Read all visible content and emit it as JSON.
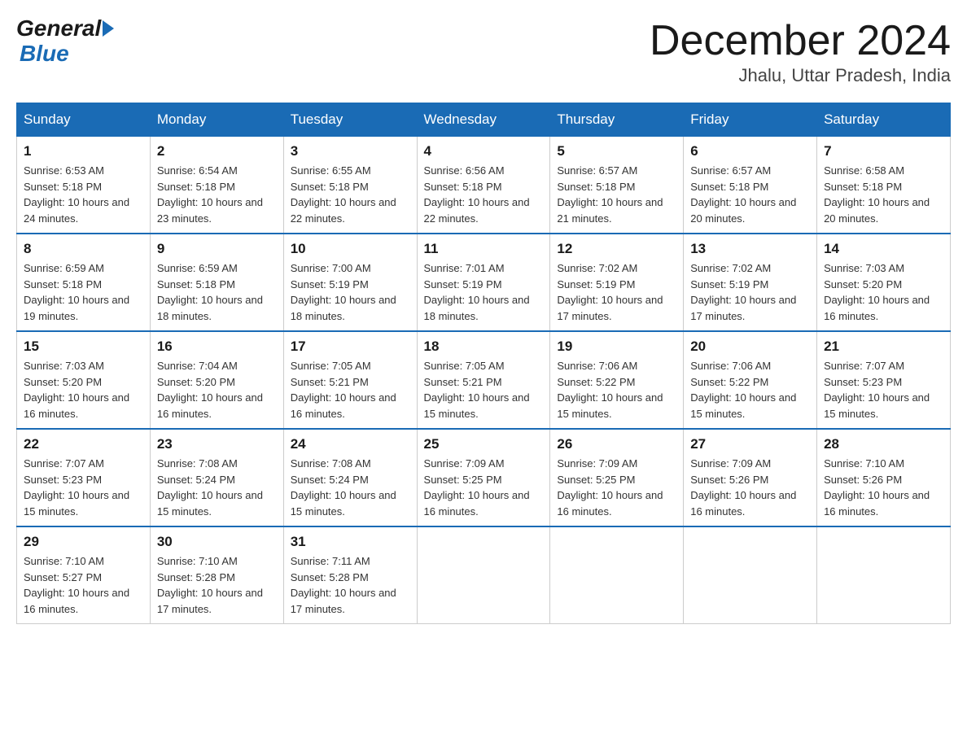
{
  "header": {
    "logo_general": "General",
    "logo_blue": "Blue",
    "month_year": "December 2024",
    "location": "Jhalu, Uttar Pradesh, India"
  },
  "days_of_week": [
    "Sunday",
    "Monday",
    "Tuesday",
    "Wednesday",
    "Thursday",
    "Friday",
    "Saturday"
  ],
  "weeks": [
    [
      {
        "day": "1",
        "sunrise": "6:53 AM",
        "sunset": "5:18 PM",
        "daylight": "10 hours and 24 minutes."
      },
      {
        "day": "2",
        "sunrise": "6:54 AM",
        "sunset": "5:18 PM",
        "daylight": "10 hours and 23 minutes."
      },
      {
        "day": "3",
        "sunrise": "6:55 AM",
        "sunset": "5:18 PM",
        "daylight": "10 hours and 22 minutes."
      },
      {
        "day": "4",
        "sunrise": "6:56 AM",
        "sunset": "5:18 PM",
        "daylight": "10 hours and 22 minutes."
      },
      {
        "day": "5",
        "sunrise": "6:57 AM",
        "sunset": "5:18 PM",
        "daylight": "10 hours and 21 minutes."
      },
      {
        "day": "6",
        "sunrise": "6:57 AM",
        "sunset": "5:18 PM",
        "daylight": "10 hours and 20 minutes."
      },
      {
        "day": "7",
        "sunrise": "6:58 AM",
        "sunset": "5:18 PM",
        "daylight": "10 hours and 20 minutes."
      }
    ],
    [
      {
        "day": "8",
        "sunrise": "6:59 AM",
        "sunset": "5:18 PM",
        "daylight": "10 hours and 19 minutes."
      },
      {
        "day": "9",
        "sunrise": "6:59 AM",
        "sunset": "5:18 PM",
        "daylight": "10 hours and 18 minutes."
      },
      {
        "day": "10",
        "sunrise": "7:00 AM",
        "sunset": "5:19 PM",
        "daylight": "10 hours and 18 minutes."
      },
      {
        "day": "11",
        "sunrise": "7:01 AM",
        "sunset": "5:19 PM",
        "daylight": "10 hours and 18 minutes."
      },
      {
        "day": "12",
        "sunrise": "7:02 AM",
        "sunset": "5:19 PM",
        "daylight": "10 hours and 17 minutes."
      },
      {
        "day": "13",
        "sunrise": "7:02 AM",
        "sunset": "5:19 PM",
        "daylight": "10 hours and 17 minutes."
      },
      {
        "day": "14",
        "sunrise": "7:03 AM",
        "sunset": "5:20 PM",
        "daylight": "10 hours and 16 minutes."
      }
    ],
    [
      {
        "day": "15",
        "sunrise": "7:03 AM",
        "sunset": "5:20 PM",
        "daylight": "10 hours and 16 minutes."
      },
      {
        "day": "16",
        "sunrise": "7:04 AM",
        "sunset": "5:20 PM",
        "daylight": "10 hours and 16 minutes."
      },
      {
        "day": "17",
        "sunrise": "7:05 AM",
        "sunset": "5:21 PM",
        "daylight": "10 hours and 16 minutes."
      },
      {
        "day": "18",
        "sunrise": "7:05 AM",
        "sunset": "5:21 PM",
        "daylight": "10 hours and 15 minutes."
      },
      {
        "day": "19",
        "sunrise": "7:06 AM",
        "sunset": "5:22 PM",
        "daylight": "10 hours and 15 minutes."
      },
      {
        "day": "20",
        "sunrise": "7:06 AM",
        "sunset": "5:22 PM",
        "daylight": "10 hours and 15 minutes."
      },
      {
        "day": "21",
        "sunrise": "7:07 AM",
        "sunset": "5:23 PM",
        "daylight": "10 hours and 15 minutes."
      }
    ],
    [
      {
        "day": "22",
        "sunrise": "7:07 AM",
        "sunset": "5:23 PM",
        "daylight": "10 hours and 15 minutes."
      },
      {
        "day": "23",
        "sunrise": "7:08 AM",
        "sunset": "5:24 PM",
        "daylight": "10 hours and 15 minutes."
      },
      {
        "day": "24",
        "sunrise": "7:08 AM",
        "sunset": "5:24 PM",
        "daylight": "10 hours and 15 minutes."
      },
      {
        "day": "25",
        "sunrise": "7:09 AM",
        "sunset": "5:25 PM",
        "daylight": "10 hours and 16 minutes."
      },
      {
        "day": "26",
        "sunrise": "7:09 AM",
        "sunset": "5:25 PM",
        "daylight": "10 hours and 16 minutes."
      },
      {
        "day": "27",
        "sunrise": "7:09 AM",
        "sunset": "5:26 PM",
        "daylight": "10 hours and 16 minutes."
      },
      {
        "day": "28",
        "sunrise": "7:10 AM",
        "sunset": "5:26 PM",
        "daylight": "10 hours and 16 minutes."
      }
    ],
    [
      {
        "day": "29",
        "sunrise": "7:10 AM",
        "sunset": "5:27 PM",
        "daylight": "10 hours and 16 minutes."
      },
      {
        "day": "30",
        "sunrise": "7:10 AM",
        "sunset": "5:28 PM",
        "daylight": "10 hours and 17 minutes."
      },
      {
        "day": "31",
        "sunrise": "7:11 AM",
        "sunset": "5:28 PM",
        "daylight": "10 hours and 17 minutes."
      },
      null,
      null,
      null,
      null
    ]
  ]
}
